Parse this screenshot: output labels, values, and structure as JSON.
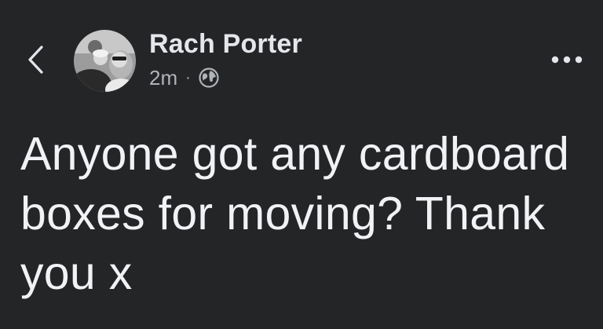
{
  "post": {
    "author": "Rach Porter",
    "timestamp": "2m",
    "separator": "·",
    "privacy_icon": "globe-icon",
    "text": "Anyone got any cardboard boxes for moving? Thank you x"
  },
  "header": {
    "back_icon": "chevron-left-icon",
    "more_icon": "more-horizontal-icon"
  },
  "colors": {
    "background": "#242526",
    "primary_text": "#e4e6eb",
    "secondary_text": "#b0b3b8"
  }
}
